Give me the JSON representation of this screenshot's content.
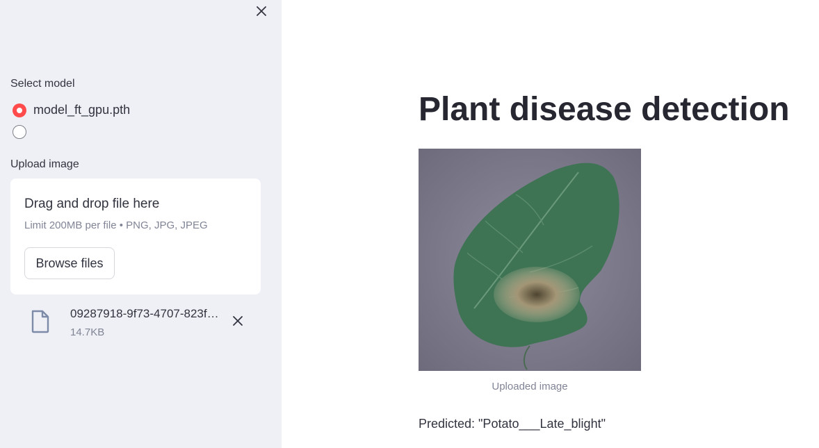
{
  "sidebar": {
    "close_icon": "close-icon",
    "model_label": "Select model",
    "model_options": [
      {
        "label": "model_ft_gpu.pth",
        "selected": true
      },
      {
        "label": "",
        "selected": false
      }
    ],
    "upload_label": "Upload image",
    "dropzone": {
      "title": "Drag and drop file here",
      "limit_text": "Limit 200MB per file • PNG, JPG, JPEG",
      "browse_label": "Browse files"
    },
    "uploaded_file": {
      "name": "09287918-9f73-4707-823f…",
      "size": "14.7KB",
      "icon": "file-icon",
      "remove_icon": "close-icon"
    }
  },
  "main": {
    "title": "Plant disease detection",
    "image_caption": "Uploaded image",
    "prediction": "Predicted: \"Potato___Late_blight\""
  },
  "colors": {
    "sidebar_bg": "#eef0f5",
    "accent": "#ff4b4b",
    "text": "#31333f",
    "muted": "#808495"
  }
}
